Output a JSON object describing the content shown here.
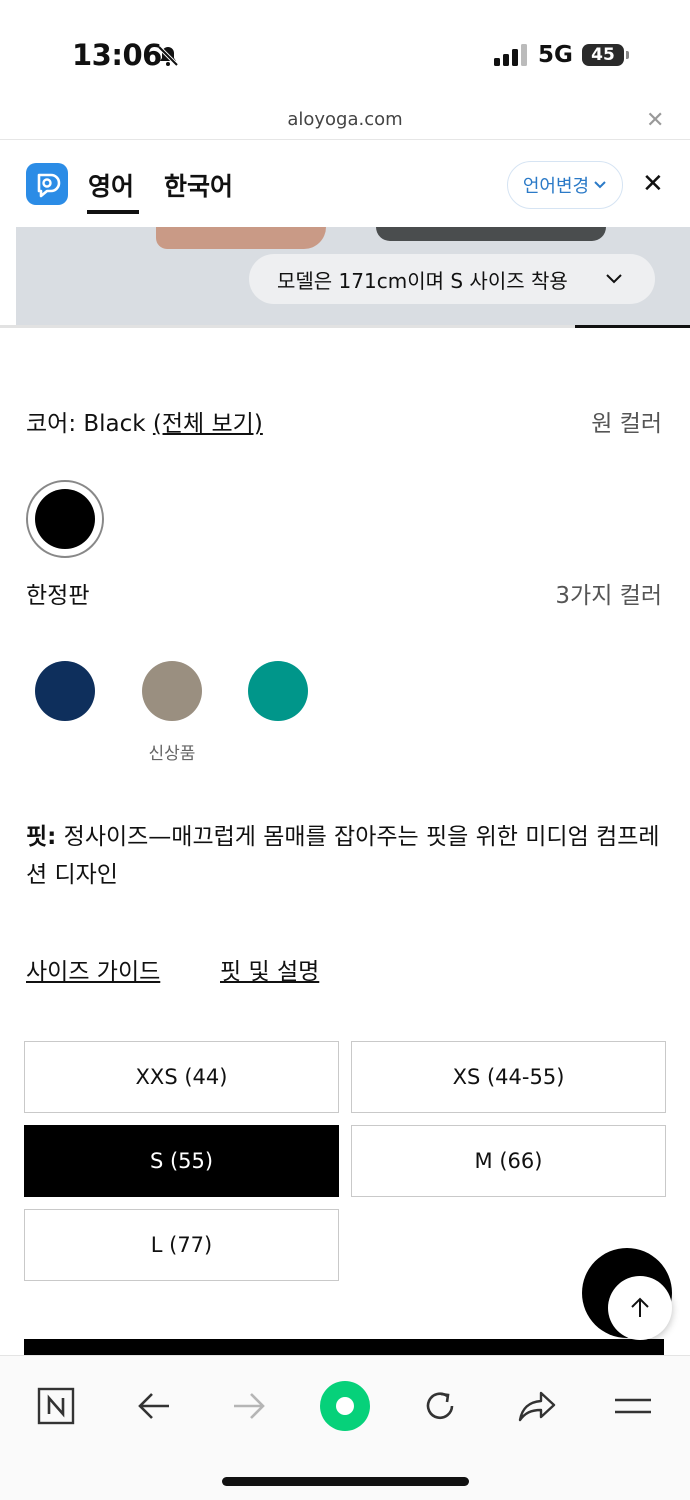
{
  "status_bar": {
    "time": "13:06",
    "network": "5G",
    "battery": "45"
  },
  "browser": {
    "url": "aloyoga.com",
    "close_icon": "close-icon"
  },
  "translator": {
    "tab_english": "영어",
    "tab_korean": "한국어",
    "change_language": "언어변경",
    "active_tab": "영어",
    "accent_color": "#2b7ac7"
  },
  "product": {
    "model_info": "모델은 171cm이며 S 사이즈 착용",
    "image_progress": 0.17,
    "core_label": "코어: Black ",
    "core_view_all": "(전체 보기)",
    "core_count": "원 컬러",
    "limited_label": "한정판",
    "limited_count": "3가지 컬러",
    "swatches_core": [
      {
        "color": "#000000",
        "selected": true
      }
    ],
    "swatches_limited": [
      {
        "color": "#0e2f5c"
      },
      {
        "color": "#9a8f80",
        "badge": "신상품"
      },
      {
        "color": "#00968a"
      }
    ],
    "fit_label": "핏:",
    "fit_text": " 정사이즈—매끄럽게 몸매를 잡아주는 핏을 위한 미디엄 컴프레션 디자인",
    "size_guide_link": "사이즈 가이드",
    "fit_details_link": "핏 및 설명",
    "sizes": [
      "XXS (44)",
      "XS (44-55)",
      "S (55)",
      "M (66)",
      "L (77)"
    ],
    "selected_size": "S (55)"
  }
}
